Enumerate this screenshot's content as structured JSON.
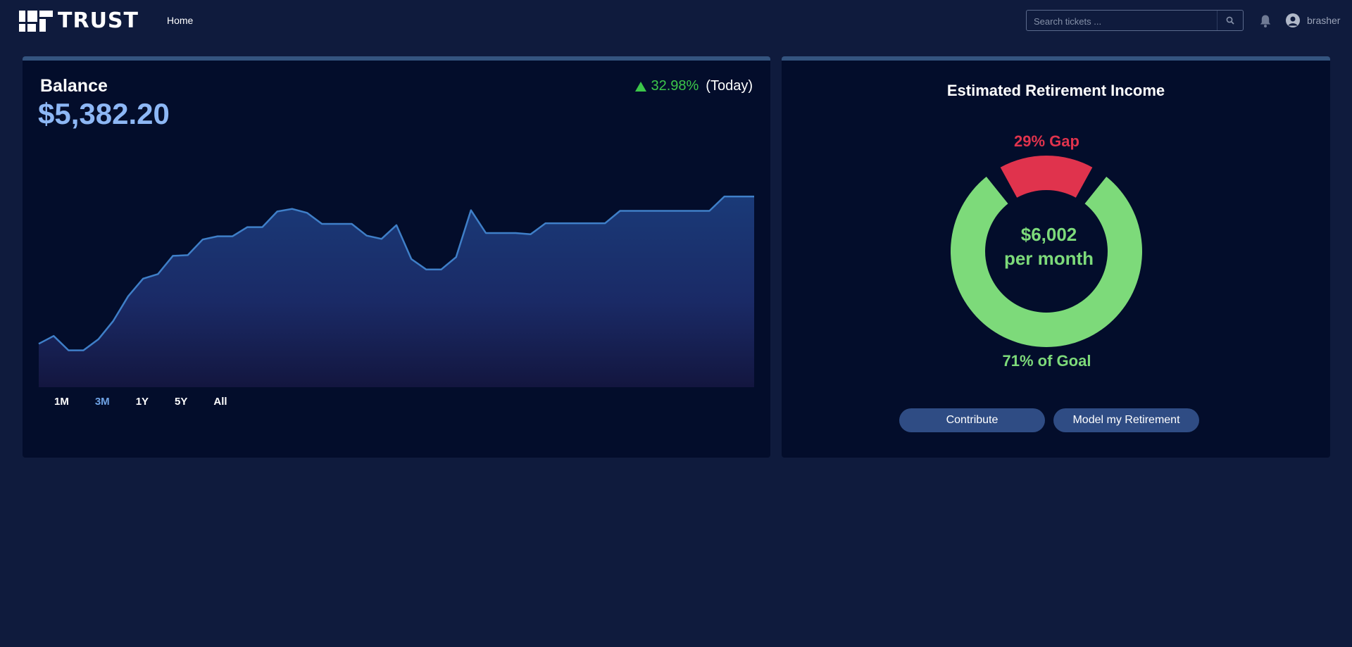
{
  "header": {
    "brand": "TRUST",
    "nav_home": "Home",
    "search_placeholder": "Search tickets ...",
    "username": "brasher"
  },
  "balance_card": {
    "title": "Balance",
    "value": "$5,382.20",
    "change_pct": "32.98%",
    "change_label": "(Today)",
    "ranges": [
      "1M",
      "3M",
      "1Y",
      "5Y",
      "All"
    ],
    "active_range": "3M"
  },
  "retirement_card": {
    "title": "Estimated Retirement Income",
    "gap_label": "29% Gap",
    "amount": "$6,002",
    "amount_unit": "per month",
    "goal_label": "71% of Goal",
    "gap_fraction": 0.29,
    "goal_fraction": 0.71,
    "buttons": {
      "contribute": "Contribute",
      "model": "Model my Retirement"
    }
  },
  "colors": {
    "background": "#0f1b3d",
    "card": "#030d2b",
    "line": "#3f7fc8",
    "accent_blue": "#8db7f5",
    "positive": "#3cc64a",
    "goal_green": "#7dda7a",
    "gap_red": "#e0334d",
    "button": "#2f4c84"
  },
  "icons": {
    "search": "search-icon",
    "bell": "bell-icon",
    "avatar": "user-avatar-icon",
    "change": "triangle-up-icon"
  },
  "chart_data": {
    "type": "area",
    "values": [
      10,
      22,
      0,
      0,
      17,
      45,
      83,
      110,
      117,
      145,
      146,
      170,
      175,
      175,
      189,
      189,
      213,
      217,
      211,
      194,
      194,
      194,
      176,
      171,
      192,
      140,
      124,
      124,
      143,
      215,
      180,
      180,
      180,
      178,
      195,
      195,
      195,
      195,
      195,
      214,
      214,
      214,
      214,
      214,
      214,
      214,
      236,
      236,
      236
    ]
  }
}
